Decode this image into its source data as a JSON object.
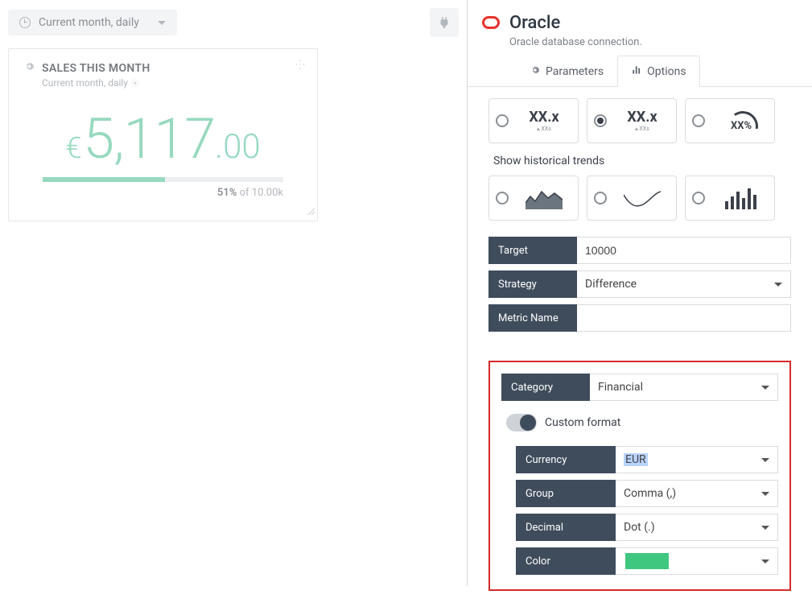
{
  "period": {
    "label": "Current month, daily"
  },
  "widget": {
    "title": "SALES THIS MONTH",
    "subtitle": "Current month, daily",
    "currencySymbol": "€",
    "valueMain": "5,117",
    "valueDecimals": ".00",
    "progressPercent": "51%",
    "progressOf": " of 10.00k"
  },
  "connection": {
    "title": "Oracle",
    "subtitle": "Oracle database connection."
  },
  "tabs": {
    "parameters": "Parameters",
    "options": "Options"
  },
  "options": {
    "trendsLabel": "Show historical trends",
    "xx": "XX.x",
    "xxsub": "▴ XXs",
    "gaugeText": "XX%",
    "target": {
      "label": "Target",
      "value": "10000"
    },
    "strategy": {
      "label": "Strategy",
      "value": "Difference"
    },
    "metricName": {
      "label": "Metric Name",
      "value": ""
    },
    "category": {
      "label": "Category",
      "value": "Financial"
    },
    "customFormat": {
      "label": "Custom format"
    },
    "currency": {
      "label": "Currency",
      "value": "EUR"
    },
    "group": {
      "label": "Group",
      "value": "Comma (,)"
    },
    "decimal": {
      "label": "Decimal",
      "value": "Dot (.)"
    },
    "color": {
      "label": "Color",
      "value": "#3fc77f"
    }
  }
}
